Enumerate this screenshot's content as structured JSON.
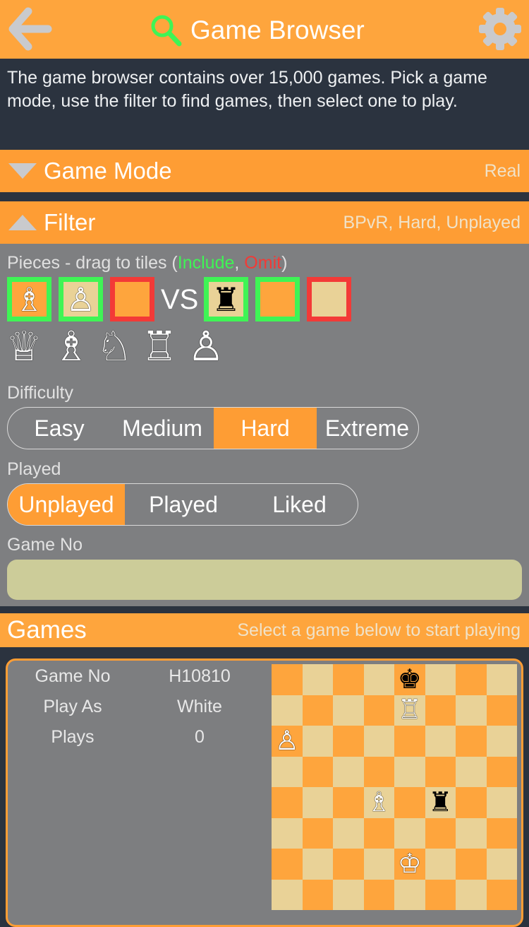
{
  "header": {
    "title": "Game Browser",
    "back_icon": "back-arrow-icon",
    "search_icon": "search-icon",
    "settings_icon": "gear-icon"
  },
  "intro": "The game browser contains over 15,000 games. Pick a game mode, use the filter to find games, then select one to play.",
  "game_mode": {
    "label": "Game Mode",
    "value": "Real",
    "expanded": false
  },
  "filter": {
    "label": "Filter",
    "summary": "BPvR, Hard, Unplayed",
    "expanded": true,
    "pieces_label_prefix": "Pieces - drag to tiles (",
    "include_label": "Include",
    "separator": ", ",
    "omit_label": "Omit",
    "pieces_label_suffix": ")",
    "vs_label": "VS",
    "white_tiles": [
      {
        "piece": "♗",
        "piece_name": "bishop",
        "mode": "include",
        "square": "orange"
      },
      {
        "piece": "♙",
        "piece_name": "pawn",
        "mode": "include",
        "square": "tan"
      },
      {
        "piece": "",
        "piece_name": "empty",
        "mode": "omit",
        "square": "orange"
      }
    ],
    "black_tiles": [
      {
        "piece": "♜",
        "piece_name": "rook",
        "mode": "include",
        "square": "tan"
      },
      {
        "piece": "",
        "piece_name": "empty",
        "mode": "include",
        "square": "orange"
      },
      {
        "piece": "",
        "piece_name": "empty",
        "mode": "omit",
        "square": "tan"
      }
    ],
    "source_pieces": [
      {
        "glyph": "♕",
        "name": "queen"
      },
      {
        "glyph": "♗",
        "name": "bishop"
      },
      {
        "glyph": "♘",
        "name": "knight"
      },
      {
        "glyph": "♖",
        "name": "rook"
      },
      {
        "glyph": "♙",
        "name": "pawn"
      }
    ],
    "difficulty": {
      "label": "Difficulty",
      "options": [
        "Easy",
        "Medium",
        "Hard",
        "Extreme"
      ],
      "selected": "Hard"
    },
    "played": {
      "label": "Played",
      "options": [
        "Unplayed",
        "Played",
        "Liked"
      ],
      "selected": "Unplayed"
    },
    "game_no": {
      "label": "Game No",
      "value": "",
      "placeholder": ""
    }
  },
  "games": {
    "label": "Games",
    "hint": "Select a game below to start playing",
    "list": [
      {
        "fields": [
          {
            "key": "Game No",
            "value": "H10810"
          },
          {
            "key": "Play As",
            "value": "White"
          },
          {
            "key": "Plays",
            "value": "0"
          }
        ],
        "position": [
          [
            "",
            "",
            "",
            "",
            "♚",
            "",
            "",
            ""
          ],
          [
            "",
            "",
            "",
            "",
            "♖",
            "",
            "",
            ""
          ],
          [
            "♙",
            "",
            "",
            "",
            "",
            "",
            "",
            ""
          ],
          [
            "",
            "",
            "",
            "",
            "",
            "",
            "",
            ""
          ],
          [
            "",
            "",
            "",
            "♗",
            "",
            "♜",
            "",
            ""
          ],
          [
            "",
            "",
            "",
            "",
            "",
            "",
            "",
            ""
          ],
          [
            "",
            "",
            "",
            "",
            "♔",
            "",
            "",
            ""
          ],
          [
            "",
            "",
            "",
            "",
            "",
            "",
            "",
            ""
          ]
        ]
      }
    ]
  },
  "colors": {
    "accent_orange": "#fea53d",
    "include_green": "#3ff455",
    "omit_red": "#f33a37",
    "board_light": "#e9d297",
    "board_dark": "#fea53d"
  }
}
